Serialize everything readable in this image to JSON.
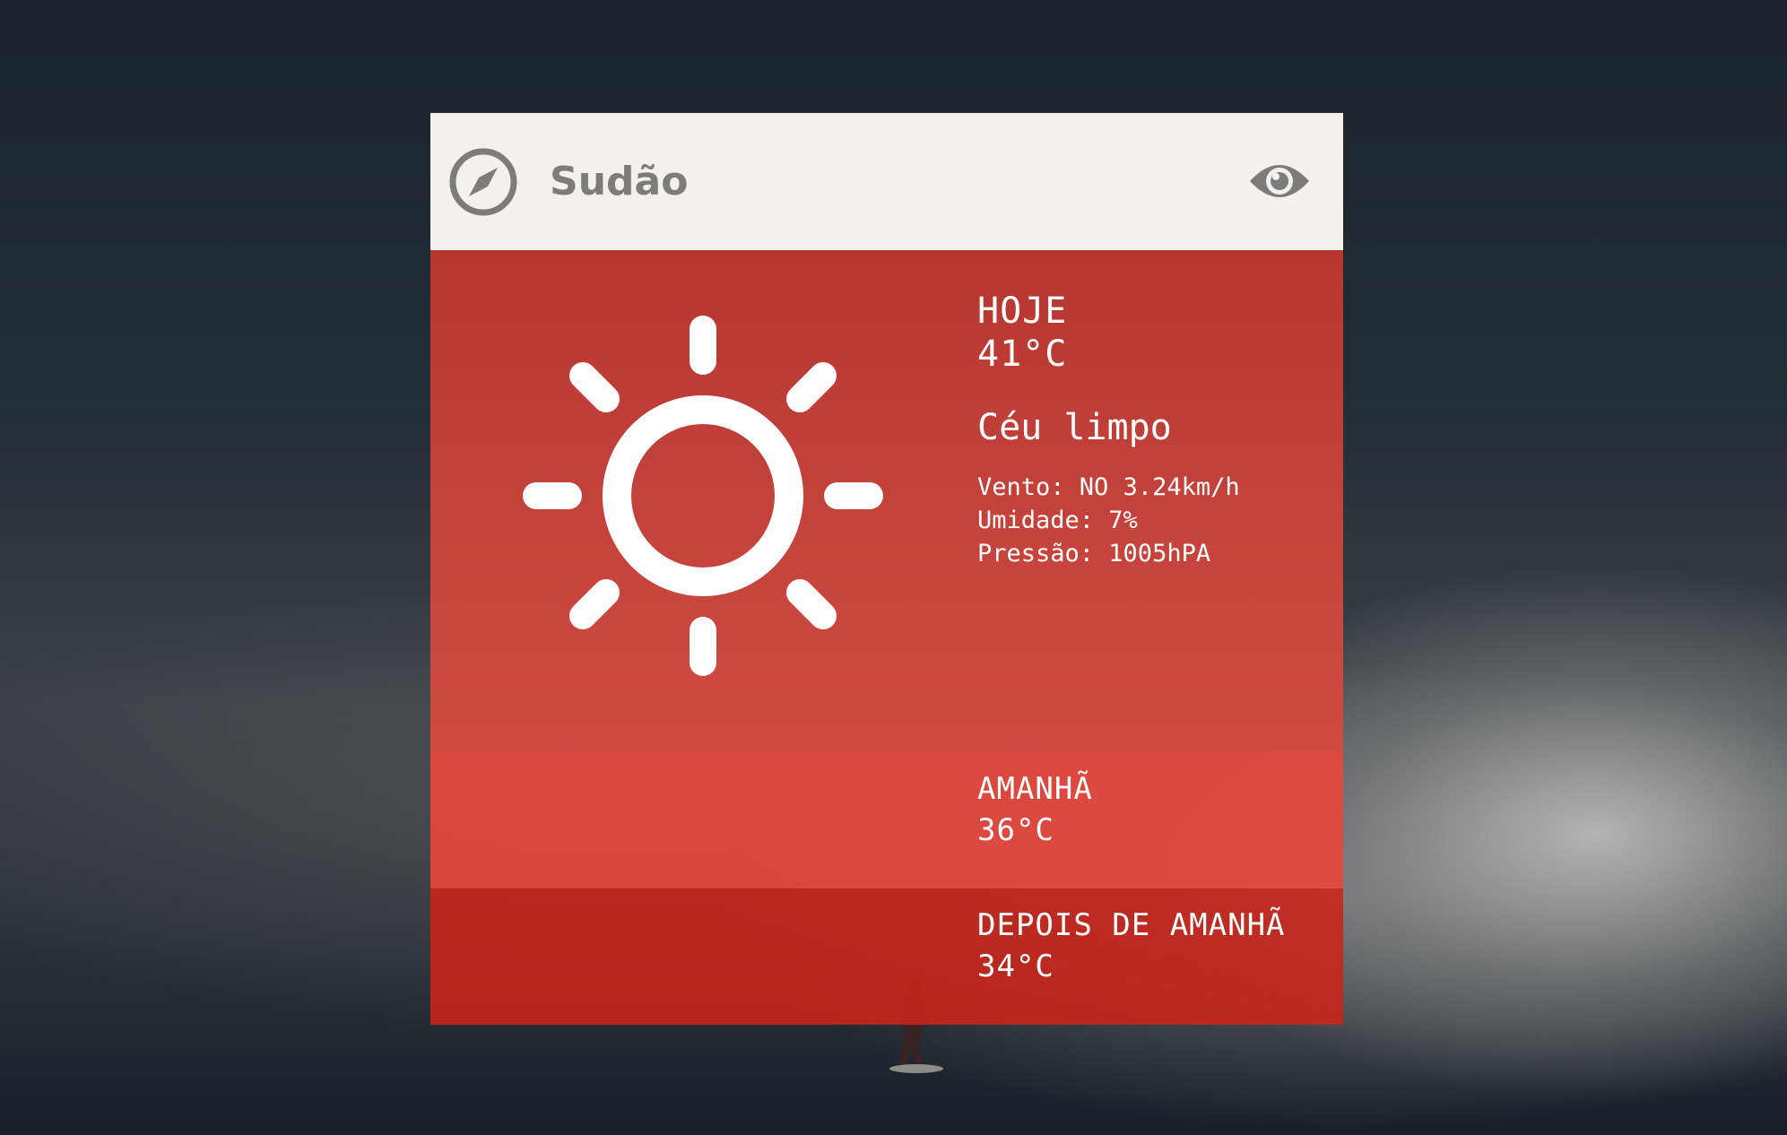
{
  "header": {
    "location": "Sudão",
    "icons": {
      "left": "compass-icon",
      "right": "eye-icon"
    },
    "header_bg": "#f4f0ec",
    "icon_color": "#7c7c7c"
  },
  "today": {
    "label": "HOJE",
    "temperature": "41°C",
    "condition": "Céu limpo",
    "icon": "sun-icon",
    "details": [
      "Vento: NO 3.24km/h",
      "Umidade: 7%",
      "Pressão: 1005hPA"
    ]
  },
  "forecast": [
    {
      "label": "AMANHÃ",
      "temperature": "36°C"
    },
    {
      "label": "DEPOIS DE AMANHÃ",
      "temperature": "34°C"
    }
  ],
  "colors": {
    "today_bg": "#c2413a",
    "tomorrow_bg": "#e6483c",
    "after_bg": "#c8261c",
    "text": "#ffffff"
  }
}
